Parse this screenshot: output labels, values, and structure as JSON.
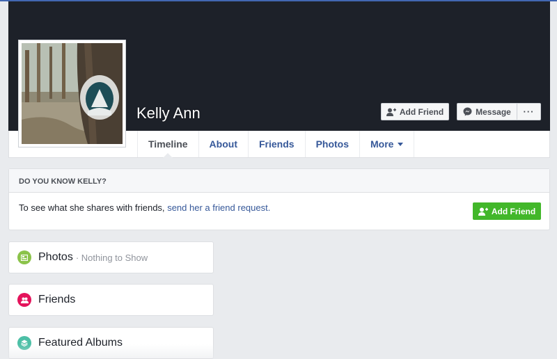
{
  "profile": {
    "name": "Kelly Ann",
    "add_friend_label": "Add Friend",
    "message_label": "Message",
    "more_label": "···"
  },
  "nav": {
    "tabs": [
      {
        "label": "Timeline",
        "active": true
      },
      {
        "label": "About"
      },
      {
        "label": "Friends"
      },
      {
        "label": "Photos"
      },
      {
        "label": "More"
      }
    ]
  },
  "know": {
    "heading": "DO YOU KNOW KELLY?",
    "text": "To see what she shares with friends,",
    "link": "send her a friend request.",
    "button_label": "Add Friend"
  },
  "cards": {
    "photos": {
      "title": "Photos",
      "sub": "· Nothing to Show"
    },
    "friends": {
      "title": "Friends"
    },
    "albums": {
      "title": "Featured Albums"
    }
  },
  "colors": {
    "cover": "#1d2129",
    "link": "#365899",
    "green": "#42b72a",
    "photos_icon": "#8bc34a",
    "friends_icon": "#e4135b",
    "albums_icon": "#4cbfa6"
  }
}
